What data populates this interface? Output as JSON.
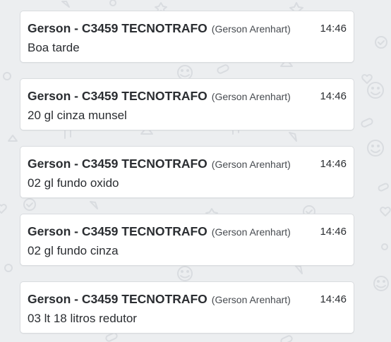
{
  "messages": [
    {
      "sender": "Gerson - C3459 TECNOTRAFO",
      "alias": "(Gerson Arenhart)",
      "time": "14:46",
      "text": "Boa tarde"
    },
    {
      "sender": "Gerson - C3459 TECNOTRAFO",
      "alias": "(Gerson Arenhart)",
      "time": "14:46",
      "text": "20 gl cinza munsel"
    },
    {
      "sender": "Gerson - C3459 TECNOTRAFO",
      "alias": "(Gerson Arenhart)",
      "time": "14:46",
      "text": "02 gl fundo oxido"
    },
    {
      "sender": "Gerson - C3459 TECNOTRAFO",
      "alias": "(Gerson Arenhart)",
      "time": "14:46",
      "text": "02 gl fundo cinza"
    },
    {
      "sender": "Gerson - C3459 TECNOTRAFO",
      "alias": "(Gerson Arenhart)",
      "time": "14:46",
      "text": "03 lt 18 litros redutor"
    }
  ],
  "colors": {
    "background": "#eceef0",
    "bubble": "#ffffff",
    "text": "#2a2d31",
    "muted": "#474b50",
    "pattern": "#dcdfe3"
  }
}
